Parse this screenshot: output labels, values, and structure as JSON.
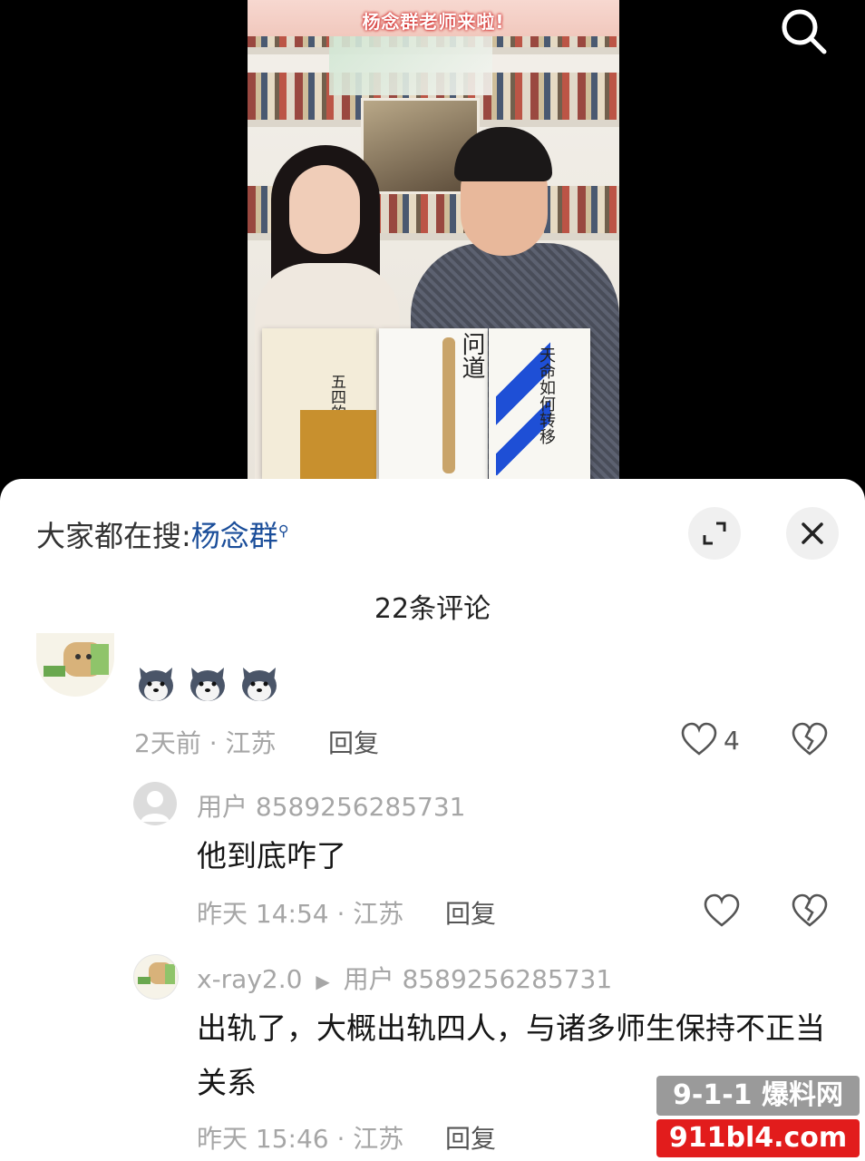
{
  "video": {
    "banner_line2": "杨念群老师来啦!",
    "book1_title": "五四的另一面",
    "book2_title": "问道",
    "book3_title": "天命如何转移"
  },
  "panel": {
    "trending_label": "大家都在搜:",
    "trending_keyword": "杨念群",
    "comment_count": "22条评论"
  },
  "comments": [
    {
      "time_location": "2天前 · 江苏",
      "reply_label": "回复",
      "like_count": "4"
    },
    {
      "username": "用户 8589256285731",
      "text": "他到底咋了",
      "time_location": "昨天 14:54 · 江苏",
      "reply_label": "回复"
    },
    {
      "username": "x-ray2.0",
      "reply_to": "用户 8589256285731",
      "text": "出轨了，大概出轨四人，与诸多师生保持不正当关系",
      "time_location": "昨天 15:46 · 江苏",
      "reply_label": "回复"
    }
  ],
  "watermark": {
    "line1": "9-1-1 爆料网",
    "line2": "911bl4.com"
  },
  "icons": {
    "search": "search-icon",
    "expand": "expand-icon",
    "close": "close-icon",
    "like": "heart-icon",
    "dislike": "broken-heart-icon",
    "emoji": "husky-emoji-icon"
  },
  "colors": {
    "keyword_blue": "#1b4e9a",
    "panel_bg": "#ffffff",
    "meta_gray": "#a6a6a6"
  }
}
